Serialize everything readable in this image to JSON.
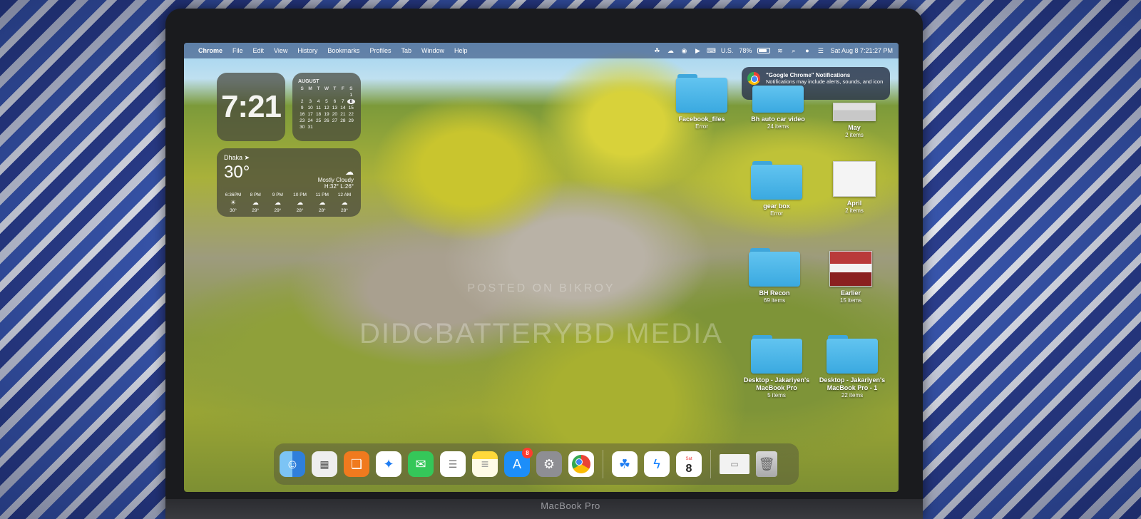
{
  "menubar": {
    "app": "Chrome",
    "items": [
      "File",
      "Edit",
      "View",
      "History",
      "Bookmarks",
      "Profiles",
      "Tab",
      "Window",
      "Help"
    ],
    "status": {
      "keyboard": "U.S.",
      "battery": "78%",
      "battery_level": 0.78,
      "datetime": "Sat Aug 8  7:21:27 PM"
    }
  },
  "widgets": {
    "clock": "7:21",
    "calendar": {
      "month": "AUGUST",
      "weekdays": [
        "S",
        "M",
        "T",
        "W",
        "T",
        "F",
        "S"
      ],
      "today": "8",
      "rows": [
        [
          "",
          "",
          "",
          "",
          "",
          "",
          "1"
        ],
        [
          "2",
          "3",
          "4",
          "5",
          "6",
          "7",
          "8"
        ],
        [
          "9",
          "10",
          "11",
          "12",
          "13",
          "14",
          "15"
        ],
        [
          "16",
          "17",
          "18",
          "19",
          "20",
          "21",
          "22"
        ],
        [
          "23",
          "24",
          "25",
          "26",
          "27",
          "28",
          "29"
        ],
        [
          "30",
          "31",
          "",
          "",
          "",
          "",
          ""
        ]
      ]
    },
    "weather": {
      "city": "Dhaka",
      "temp": "30°",
      "condition": "Mostly Cloudy",
      "hilo": "H:32° L:26°",
      "hours": [
        {
          "time": "6:36PM",
          "temp": "30°",
          "icon": "sunset-icon"
        },
        {
          "time": "8 PM",
          "temp": "29°",
          "icon": "cloud-icon"
        },
        {
          "time": "9 PM",
          "temp": "29°",
          "icon": "cloud-icon"
        },
        {
          "time": "10 PM",
          "temp": "28°",
          "icon": "cloud-icon"
        },
        {
          "time": "11 PM",
          "temp": "28°",
          "icon": "cloud-icon"
        },
        {
          "time": "12 AM",
          "temp": "28°",
          "icon": "cloud-icon"
        }
      ]
    }
  },
  "notification": {
    "title": "\"Google Chrome\" Notifications",
    "body": "Notifications may include alerts, sounds, and icon badges."
  },
  "desktop": {
    "items": [
      {
        "name": "Facebook_files",
        "sub": "Error"
      },
      {
        "name": "Bh auto car video",
        "sub": "24 items"
      },
      {
        "name": "May",
        "sub": "2 items"
      },
      {
        "name": "gear box",
        "sub": "Error"
      },
      {
        "name": "April",
        "sub": "2 items"
      },
      {
        "name": "BH Recon",
        "sub": "69 items"
      },
      {
        "name": "Earlier",
        "sub": "15 items"
      },
      {
        "name": "Desktop - Jakariyen's MacBook Pro",
        "sub": "5 items"
      },
      {
        "name": "Desktop - Jakariyen's MacBook Pro - 1",
        "sub": "22 items"
      }
    ]
  },
  "watermark": {
    "line1": "POSTED ON BIKROY",
    "line2": "DIDCBATTERYBD MEDIA"
  },
  "dock": {
    "appstore_badge": "8",
    "calendar_day": "8",
    "calendar_weekday": "Sat"
  },
  "laptop_label": "MacBook Pro"
}
